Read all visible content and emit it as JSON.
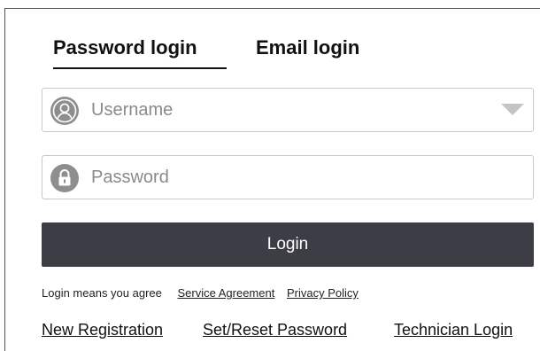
{
  "tabs": {
    "password_login": "Password login",
    "email_login": "Email login",
    "active": "password_login"
  },
  "username": {
    "placeholder": "Username",
    "value": "",
    "icon": "user-icon"
  },
  "password": {
    "placeholder": "Password",
    "value": "",
    "icon": "lock-icon"
  },
  "login_button": {
    "label": "Login"
  },
  "agreement": {
    "text": "Login means you agree",
    "service_agreement": "Service Agreement",
    "privacy_policy": "Privacy Policy"
  },
  "links": {
    "new_registration": "New Registration",
    "reset_password": "Set/Reset Password",
    "technician_login": "Technician Login"
  },
  "colors": {
    "button_bg": "#3d3e45",
    "icon_gray": "#8e8e8e",
    "border": "#c9c9c9"
  }
}
